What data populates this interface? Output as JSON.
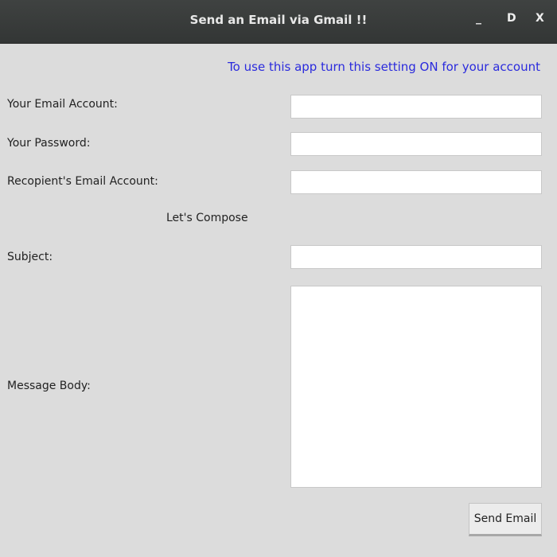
{
  "window": {
    "title": "Send an Email via Gmail !!",
    "minimize": "_",
    "maximize": "D",
    "close": "X"
  },
  "setting_link": "To use this app turn this setting ON for your account",
  "form": {
    "email_label": "Your Email Account:",
    "email_value": "",
    "password_label": "Your Password:",
    "password_value": "",
    "recipient_label": "Recopient's Email Account:",
    "recipient_value": "",
    "compose_heading": "Let's Compose",
    "subject_label": "Subject:",
    "subject_value": "",
    "body_label": "Message Body:",
    "body_value": ""
  },
  "send_button": "Send Email"
}
